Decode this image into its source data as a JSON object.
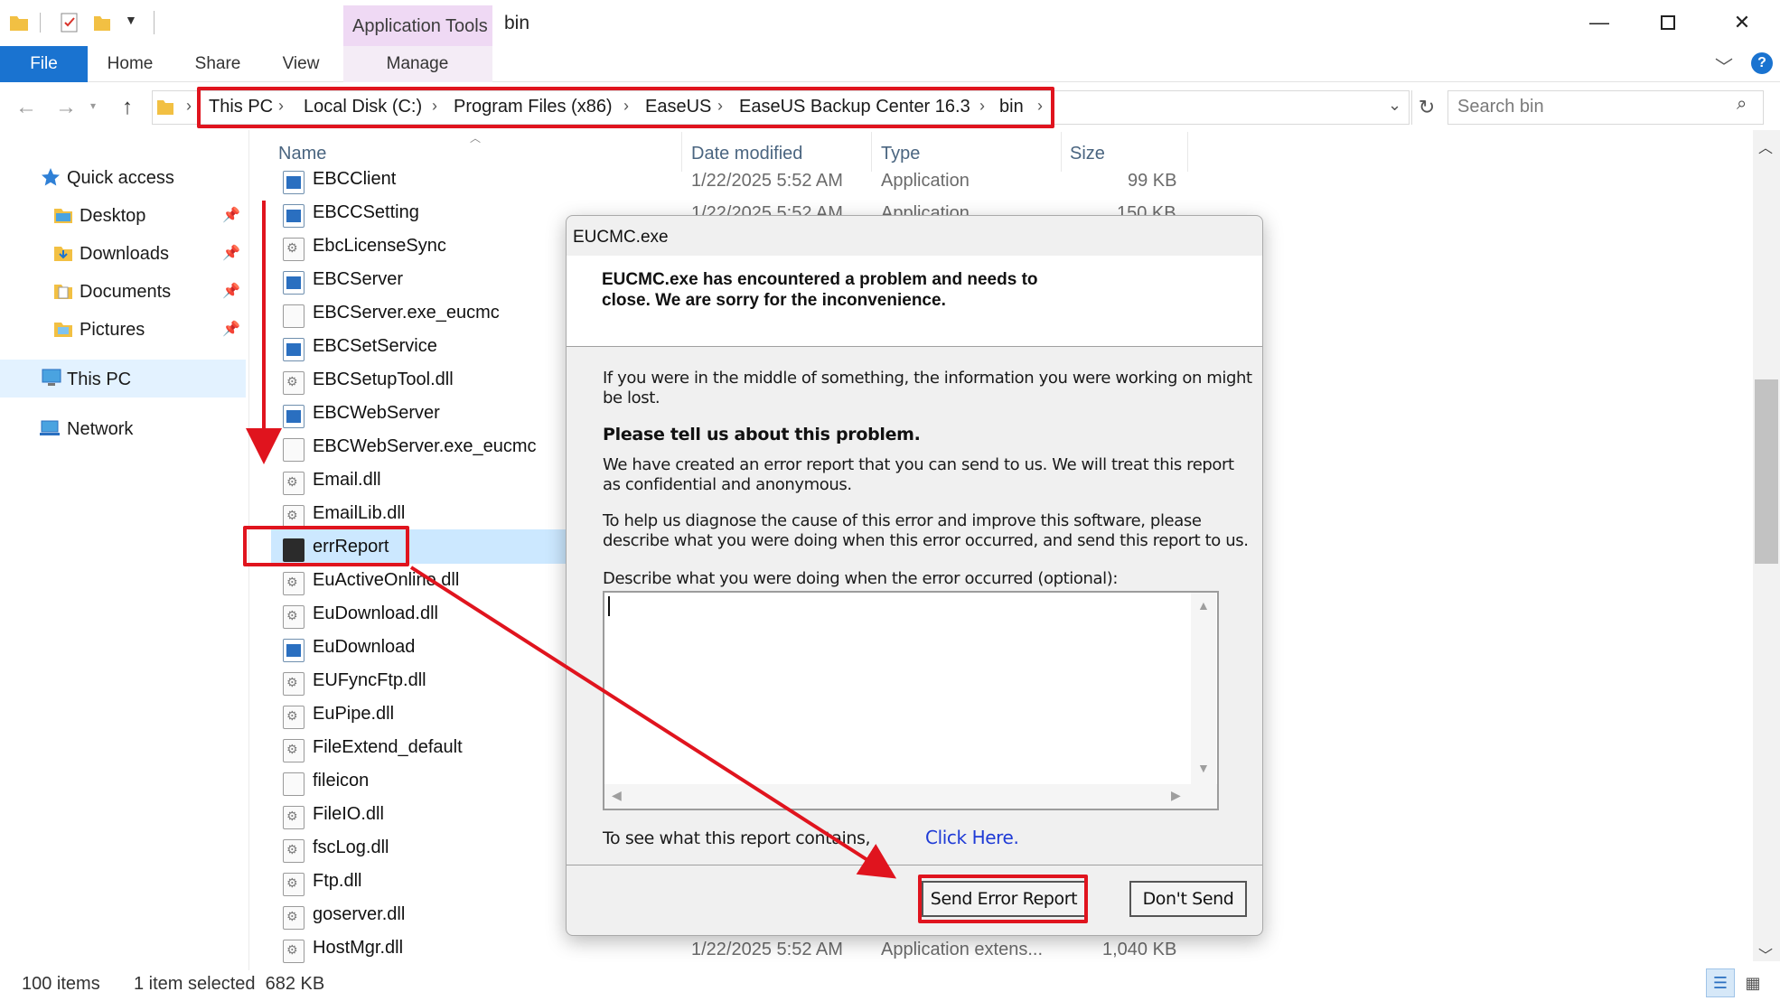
{
  "window": {
    "title": "bin",
    "context_group": "Application Tools"
  },
  "ribbon": {
    "tabs": [
      {
        "label": "File"
      },
      {
        "label": "Home"
      },
      {
        "label": "Share"
      },
      {
        "label": "View"
      },
      {
        "label": "Manage"
      }
    ]
  },
  "address": {
    "crumbs": [
      "This PC",
      "Local Disk (C:)",
      "Program Files (x86)",
      "EaseUS",
      "EaseUS Backup Center 16.3",
      "bin"
    ],
    "search_placeholder": "Search bin"
  },
  "nav": {
    "items": [
      {
        "label": "Quick access",
        "icon": "star-icon"
      },
      {
        "label": "Desktop",
        "icon": "folder-icon",
        "pinned": true
      },
      {
        "label": "Downloads",
        "icon": "downloads-folder-icon",
        "pinned": true
      },
      {
        "label": "Documents",
        "icon": "documents-folder-icon",
        "pinned": true
      },
      {
        "label": "Pictures",
        "icon": "pictures-folder-icon",
        "pinned": true
      },
      {
        "label": "This PC",
        "icon": "computer-icon",
        "selected": true
      },
      {
        "label": "Network",
        "icon": "network-icon"
      }
    ]
  },
  "columns": [
    "Name",
    "Date modified",
    "Type",
    "Size"
  ],
  "files": [
    {
      "name": "EBCClient",
      "kind": "app",
      "date": "1/22/2025 5:52 AM",
      "type": "Application",
      "size": "99 KB"
    },
    {
      "name": "EBCCSetting",
      "kind": "app",
      "date": "1/22/2025 5:52 AM",
      "type": "Application",
      "size": "150 KB"
    },
    {
      "name": "EbcLicenseSync",
      "kind": "dll"
    },
    {
      "name": "EBCServer",
      "kind": "app"
    },
    {
      "name": "EBCServer.exe_eucmc",
      "kind": "file"
    },
    {
      "name": "EBCSetService",
      "kind": "app"
    },
    {
      "name": "EBCSetupTool.dll",
      "kind": "dll"
    },
    {
      "name": "EBCWebServer",
      "kind": "app"
    },
    {
      "name": "EBCWebServer.exe_eucmc",
      "kind": "file"
    },
    {
      "name": "Email.dll",
      "kind": "dll"
    },
    {
      "name": "EmailLib.dll",
      "kind": "dll"
    },
    {
      "name": "errReport",
      "kind": "app",
      "selected": true
    },
    {
      "name": "EuActiveOnline.dll",
      "kind": "dll"
    },
    {
      "name": "EuDownload.dll",
      "kind": "dll"
    },
    {
      "name": "EuDownload",
      "kind": "app"
    },
    {
      "name": "EUFyncFtp.dll",
      "kind": "dll"
    },
    {
      "name": "EuPipe.dll",
      "kind": "dll"
    },
    {
      "name": "FileExtend_default",
      "kind": "dll"
    },
    {
      "name": "fileicon",
      "kind": "file"
    },
    {
      "name": "FileIO.dll",
      "kind": "dll"
    },
    {
      "name": "fscLog.dll",
      "kind": "dll"
    },
    {
      "name": "Ftp.dll",
      "kind": "dll"
    },
    {
      "name": "goserver.dll",
      "kind": "dll"
    },
    {
      "name": "HostMgr.dll",
      "kind": "dll",
      "date": "1/22/2025 5:52 AM",
      "type": "Application extens...",
      "size": "1,040 KB"
    }
  ],
  "status": {
    "items": "100 items",
    "selection": "1 item selected  682 KB"
  },
  "dialog": {
    "title": "EUCMC.exe",
    "header_line1": "EUCMC.exe has encountered a problem and needs to",
    "header_line2": "close.  We are sorry for the inconvenience.",
    "para1_line1": "If you were in the middle of something, the information you were working on might",
    "para1_line2": "be lost.",
    "bold_heading": "Please tell us about this problem.",
    "para2_line1": "We have created an error report that you can send to us.  We will treat this report",
    "para2_line2": "as confidential and anonymous.",
    "para3_line1": "To help us diagnose the cause of this error and improve this software, please",
    "para3_line2": "describe what you were doing when this error occurred, and send this report to us.",
    "textarea_label": "Describe what you were doing when the error occurred  (optional):",
    "textarea_value": "",
    "report_text": "To see what this report contains,",
    "link_label": "Click Here.",
    "send_button": "Send Error Report",
    "dont_send_button": "Don't Send"
  },
  "colors": {
    "accent": "#1a73d0",
    "annotation": "#e0141e",
    "selection": "#cce8ff",
    "context_tab": "#efd9f4"
  }
}
